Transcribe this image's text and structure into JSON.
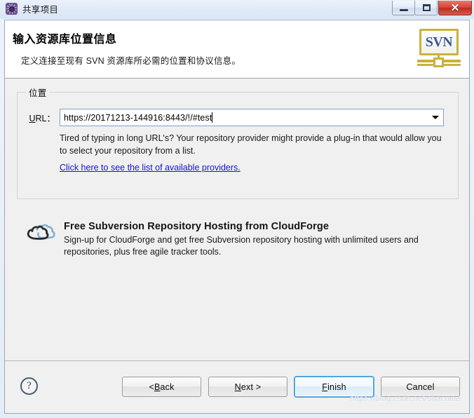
{
  "window": {
    "title": "共享项目",
    "icon": "gear-icon",
    "controls": {
      "minimize": "–",
      "maximize": "❐",
      "close": "✕"
    }
  },
  "header": {
    "title": "输入资源库位置信息",
    "subtitle": "定义连接至现有 SVN 资源库所必需的位置和协议信息。",
    "logo_text": "SVN",
    "logo_accent": "#c9b23f",
    "logo_text_color": "#3a5a94"
  },
  "location_group": {
    "legend": "位置",
    "url_label_mnemonic": "U",
    "url_label_rest": "RL：",
    "url_value": "https://20171213-144916:8443/!/#test",
    "url_placeholder": "",
    "hint": "Tired of typing in long URL's?  Your repository provider might provide a plug-in that would allow you to select your repository from a list.",
    "link_text": "Click here to see the list of available providers.",
    "link_color": "#1414cf"
  },
  "cloudforge": {
    "icon": "cloud-icon",
    "title": "Free Subversion Repository Hosting from CloudForge",
    "body": "Sign-up for CloudForge and get free Subversion repository hosting with unlimited users and repositories, plus free agile tracker tools.",
    "cloud_dark": "#2b2b2b",
    "cloud_light": "#7fb2d9"
  },
  "footer": {
    "help_glyph": "?",
    "buttons": {
      "back": {
        "pre": "< ",
        "mnemonic": "B",
        "post": "ack"
      },
      "next": {
        "pre": "",
        "mnemonic": "N",
        "post": "ext >"
      },
      "finish": {
        "pre": "",
        "mnemonic": "F",
        "post": "inish",
        "is_default": true
      },
      "cancel": {
        "pre": "",
        "mnemonic": "",
        "post": "Cancel"
      }
    }
  },
  "watermark": {
    "text": "https://blog.csdn.net/shacuiaa"
  }
}
